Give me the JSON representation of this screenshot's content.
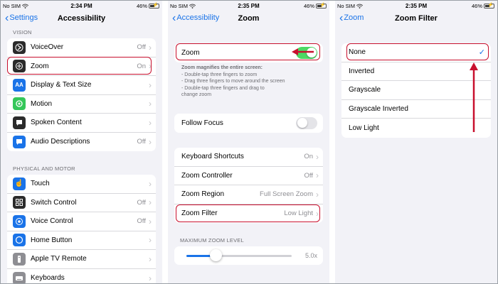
{
  "colors": {
    "accent": "#1a73e8",
    "highlight": "#c8102e",
    "toggle_on": "#4cd964"
  },
  "screens": [
    {
      "status": {
        "carrier": "No SIM",
        "time": "2:34 PM",
        "battery": "46%"
      },
      "nav": {
        "back": "Settings",
        "title": "Accessibility"
      },
      "sections": [
        {
          "label": "VISION",
          "rows": [
            {
              "label": "VoiceOver",
              "value": "Off",
              "icon": "voiceover-icon"
            },
            {
              "label": "Zoom",
              "value": "On",
              "icon": "zoom-icon"
            },
            {
              "label": "Display & Text Size",
              "value": "",
              "icon": "text-size-icon"
            },
            {
              "label": "Motion",
              "value": "",
              "icon": "motion-icon"
            },
            {
              "label": "Spoken Content",
              "value": "",
              "icon": "speech-bubble-icon"
            },
            {
              "label": "Audio Descriptions",
              "value": "Off",
              "icon": "audio-description-icon"
            }
          ]
        },
        {
          "label": "PHYSICAL AND MOTOR",
          "rows": [
            {
              "label": "Touch",
              "value": "",
              "icon": "hand-icon"
            },
            {
              "label": "Switch Control",
              "value": "Off",
              "icon": "switch-control-icon"
            },
            {
              "label": "Voice Control",
              "value": "Off",
              "icon": "voice-control-icon"
            },
            {
              "label": "Home Button",
              "value": "",
              "icon": "home-button-icon"
            },
            {
              "label": "Apple TV Remote",
              "value": "",
              "icon": "remote-icon"
            },
            {
              "label": "Keyboards",
              "value": "",
              "icon": "keyboard-icon"
            }
          ]
        }
      ]
    },
    {
      "status": {
        "carrier": "No SIM",
        "time": "2:35 PM",
        "battery": "46%"
      },
      "nav": {
        "back": "Accessibility",
        "title": "Zoom"
      },
      "zoom_row": {
        "label": "Zoom",
        "on": true
      },
      "footnote": [
        "Zoom magnifies the entire screen:",
        "- Double-tap three fingers to zoom",
        "- Drag three fingers to move around the screen",
        "- Double-tap three fingers and drag to",
        "change zoom"
      ],
      "follow_focus": {
        "label": "Follow Focus",
        "on": false
      },
      "rows": [
        {
          "label": "Keyboard Shortcuts",
          "value": "On"
        },
        {
          "label": "Zoom Controller",
          "value": "Off"
        },
        {
          "label": "Zoom Region",
          "value": "Full Screen Zoom"
        },
        {
          "label": "Zoom Filter",
          "value": "Low Light"
        }
      ],
      "max_zoom": {
        "label": "MAXIMUM ZOOM LEVEL",
        "value": "5.0x",
        "fraction": 0.28
      }
    },
    {
      "status": {
        "carrier": "No SIM",
        "time": "2:35 PM",
        "battery": "46%"
      },
      "nav": {
        "back": "Zoom",
        "title": "Zoom Filter"
      },
      "options": [
        {
          "label": "None",
          "selected": true
        },
        {
          "label": "Inverted",
          "selected": false
        },
        {
          "label": "Grayscale",
          "selected": false
        },
        {
          "label": "Grayscale Inverted",
          "selected": false
        },
        {
          "label": "Low Light",
          "selected": false
        }
      ]
    }
  ]
}
